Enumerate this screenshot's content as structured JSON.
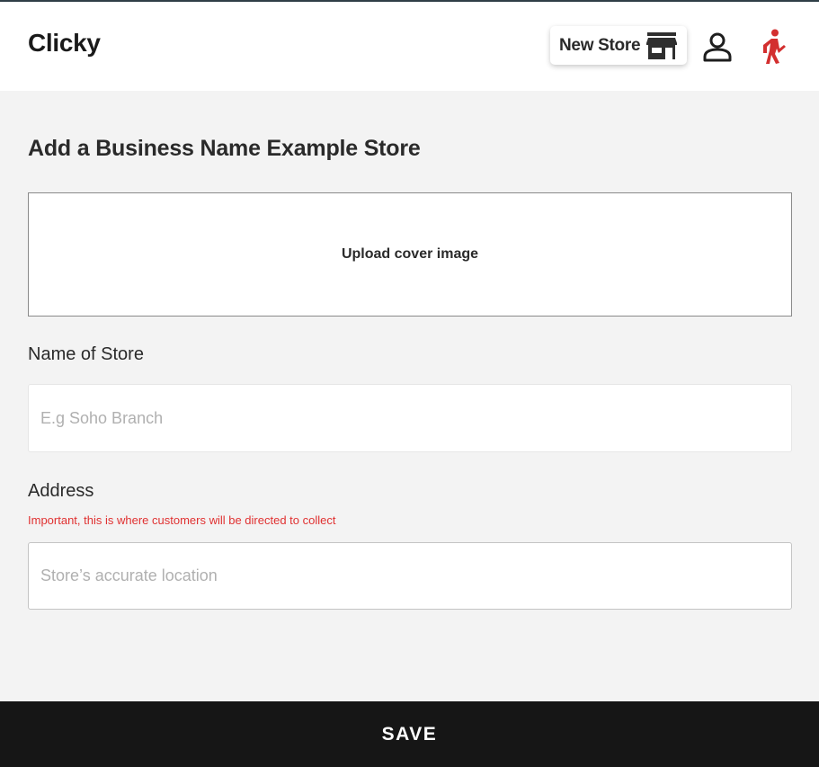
{
  "app": {
    "brand": "Clicky"
  },
  "header": {
    "new_store_label": "New Store",
    "icons": [
      "store-icon",
      "user-icon",
      "walking-person-icon"
    ],
    "walk_icon_color": "#d32f2f"
  },
  "page": {
    "title": "Add a Business Name Example Store"
  },
  "cover": {
    "upload_label": "Upload cover image"
  },
  "store_name": {
    "label": "Name of Store",
    "value": "",
    "placeholder": "E.g Soho Branch"
  },
  "address": {
    "label": "Address",
    "hint": "Important, this is where customers will be directed to collect",
    "hint_color": "#e03131",
    "value": "",
    "placeholder": "Store’s accurate location"
  },
  "footer": {
    "save_label": "SAVE"
  }
}
